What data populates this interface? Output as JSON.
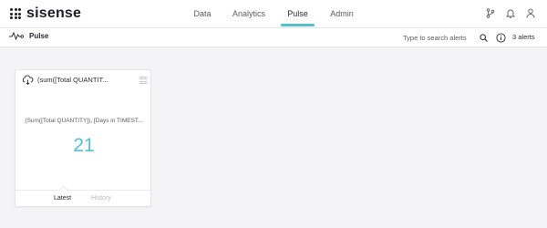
{
  "app": {
    "logo_text": "sisense"
  },
  "nav": {
    "items": [
      {
        "label": "Data",
        "active": false
      },
      {
        "label": "Analytics",
        "active": false
      },
      {
        "label": "Pulse",
        "active": true
      },
      {
        "label": "Admin",
        "active": false
      }
    ]
  },
  "top_icons": [
    "branch-icon",
    "bell-icon",
    "user-icon"
  ],
  "subbar": {
    "title": "Pulse",
    "search_placeholder": "Type to search alerts",
    "alerts_count": "3 alerts"
  },
  "card": {
    "title": "(sum([Total QUANTIT...",
    "subtitle": "(Sum([Total QUANTITY]), [Days in TIMEST...",
    "value": "21",
    "tabs": [
      {
        "label": "Latest",
        "active": true
      },
      {
        "label": "History",
        "active": false
      }
    ]
  },
  "colors": {
    "accent": "#52c1cc",
    "text": "#2b2b33",
    "muted": "#b9b9c2",
    "background": "#f4f4f6"
  }
}
